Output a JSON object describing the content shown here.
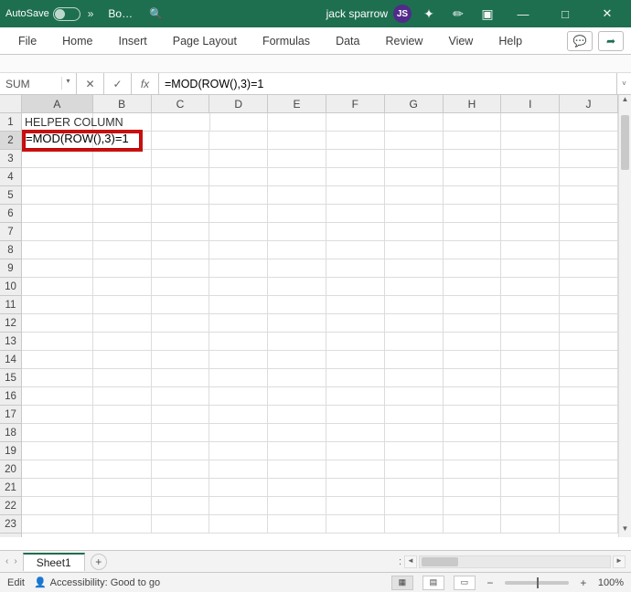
{
  "title": {
    "autosave_label": "AutoSave",
    "autosave_toggle": "Off",
    "chev": "»",
    "doc": "Bo…",
    "search_icon": "🔍",
    "user_name": "jack sparrow",
    "user_initials": "JS",
    "diamond_icon": "✦",
    "eyedrop_icon": "✏",
    "restore_icon": "▣",
    "minimize_icon": "—",
    "maximize_icon": "□",
    "close_icon": "✕"
  },
  "ribbon": {
    "tabs": {
      "file": "File",
      "home": "Home",
      "insert": "Insert",
      "page_layout": "Page Layout",
      "formulas": "Formulas",
      "data": "Data",
      "review": "Review",
      "view": "View",
      "help": "Help"
    },
    "comments_icon": "💬",
    "share_icon": "➦"
  },
  "formula_bar": {
    "namebox": "SUM",
    "cancel_icon": "✕",
    "enter_icon": "✓",
    "fx_icon": "fx",
    "formula": "=MOD(ROW(),3)=1",
    "expand_icon": "˅"
  },
  "grid": {
    "columns": [
      "A",
      "B",
      "C",
      "D",
      "E",
      "F",
      "G",
      "H",
      "I",
      "J"
    ],
    "rows": [
      "1",
      "2",
      "3",
      "4",
      "5",
      "6",
      "7",
      "8",
      "9",
      "10",
      "11",
      "12",
      "13",
      "14",
      "15",
      "16",
      "17",
      "18",
      "19",
      "20",
      "21",
      "22",
      "23"
    ],
    "a1": "HELPER COLUMN",
    "a2": "=MOD(ROW(),3)=1"
  },
  "sheets": {
    "nav_left": "‹",
    "nav_right": "›",
    "current": "Sheet1",
    "add_icon": "+",
    "dots": ": ",
    "arrow_left": "◄",
    "arrow_right": "►"
  },
  "status": {
    "mode": "Edit",
    "accessibility": "Accessibility: Good to go",
    "acc_icon": "👤",
    "normal_icon": "▦",
    "pagelayout_icon": "▤",
    "pagebreak_icon": "▭",
    "zoom_minus": "−",
    "zoom_plus": "+",
    "zoom_value": "100%"
  }
}
